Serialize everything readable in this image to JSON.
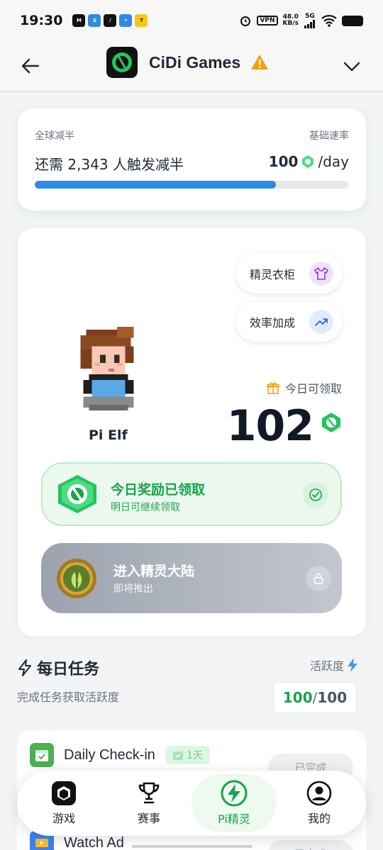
{
  "status_bar": {
    "time": "19:30",
    "vpn": "VPN",
    "speed_value": "48.0",
    "speed_unit": "KB/s",
    "network": "5G"
  },
  "header": {
    "title": "CiDi Games",
    "back_icon": "arrow-left-icon",
    "warning_icon": "warning-triangle-icon",
    "menu_icon": "chevron-down-icon"
  },
  "halving": {
    "left_label": "全球减半",
    "right_label": "基础速率",
    "message": "还需 2,343 人触发减半",
    "rate_value": "100",
    "rate_unit": "/day",
    "progress": 0.77
  },
  "elf": {
    "wardrobe_label": "精灵衣柜",
    "boost_label": "效率加成",
    "name": "Pi Elf",
    "claimable_label": "今日可领取",
    "claimable_amount": "102",
    "reward_title": "今日奖励已领取",
    "reward_sub": "明日可继续领取",
    "land_title": "进入精灵大陆",
    "land_sub": "即将推出"
  },
  "tasks": {
    "title": "每日任务",
    "subtitle": "完成任务获取活跃度",
    "activity_label": "活跃度",
    "activity_current": "100",
    "activity_sep": " / ",
    "activity_max": "100",
    "items": [
      {
        "name": "Daily Check-in",
        "badge": "1天",
        "status": "已完成"
      },
      {
        "name": "Watch Ad",
        "status": "已完成"
      }
    ]
  },
  "nav": {
    "items": [
      {
        "label": "游戏",
        "icon": "game-icon"
      },
      {
        "label": "赛事",
        "icon": "trophy-icon"
      },
      {
        "label": "Pi精灵",
        "icon": "bolt-icon",
        "active": true
      },
      {
        "label": "我的",
        "icon": "profile-icon"
      }
    ]
  },
  "colors": {
    "accent_green": "#16a34a",
    "progress_blue": "#2b8be6"
  }
}
